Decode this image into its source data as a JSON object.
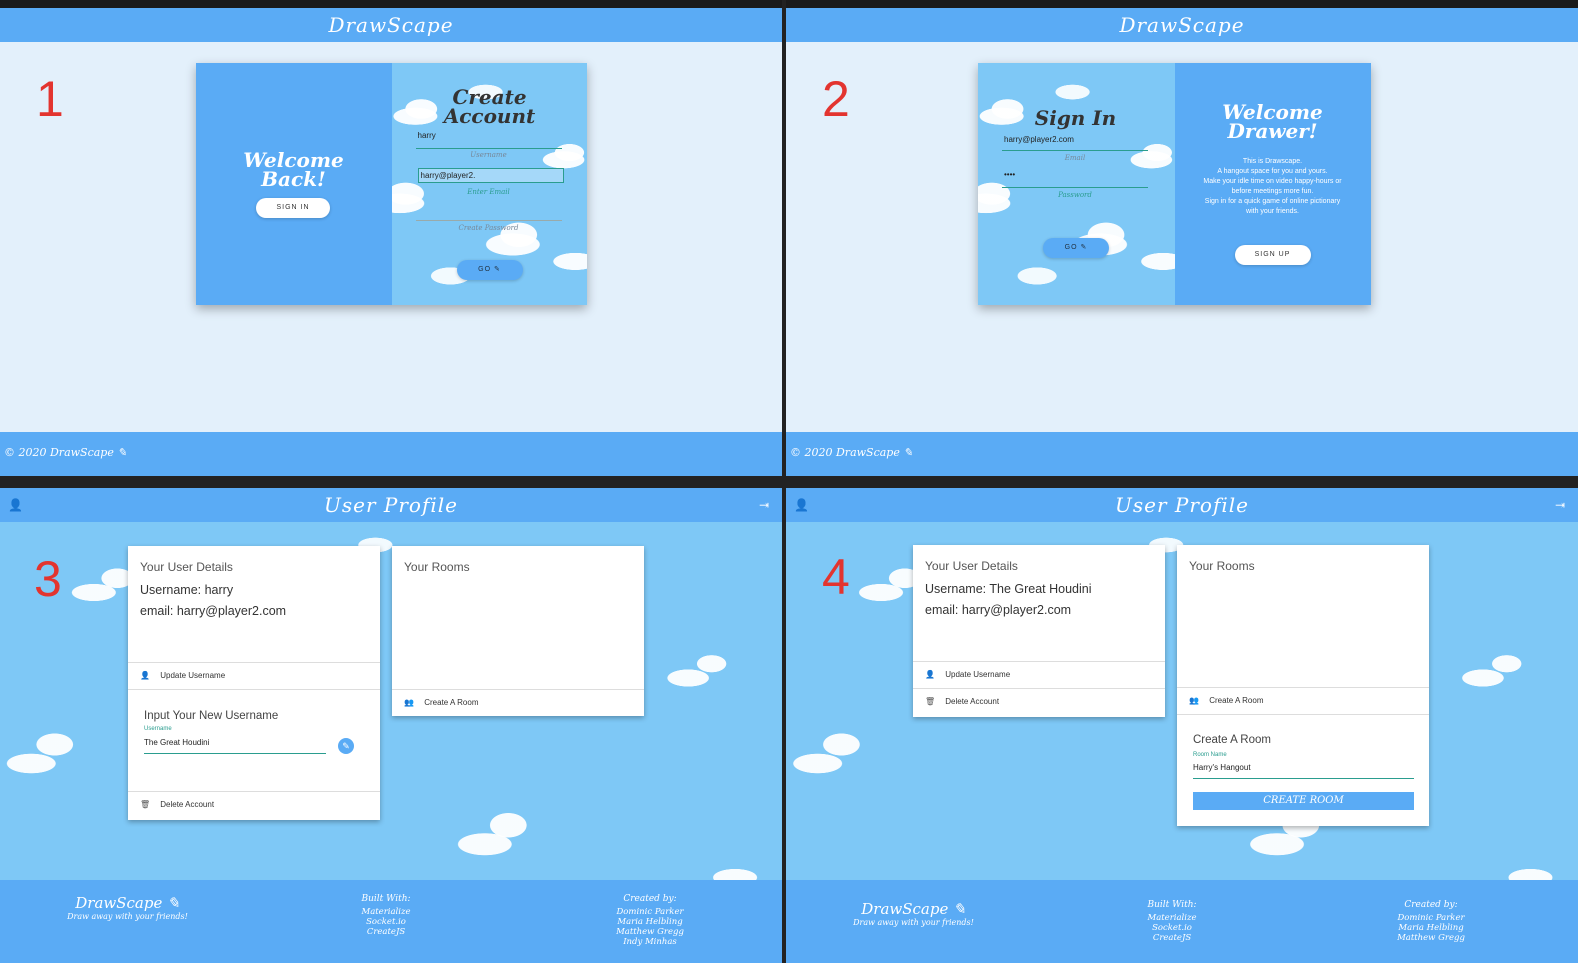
{
  "colors": {
    "primary": "#5aabf5",
    "light_bg": "#e3f0fb",
    "sky": "#7ec8f6",
    "accent_teal": "#2a9d8f",
    "step_number": "#e3342f"
  },
  "panel1": {
    "step": "1",
    "header_title": "DrawScape",
    "welcome_title": "Welcome Back!",
    "sign_in_button": "SIGN IN",
    "create_title": "Create Account",
    "username_value": "harry",
    "username_hint": "Username",
    "email_value": "harry@player2.",
    "email_hint": "Enter Email",
    "password_hint": "Create Password",
    "go_button": "GO",
    "copyright": "© 2020 DrawScape"
  },
  "panel2": {
    "step": "2",
    "header_title": "DrawScape",
    "sign_in_title": "Sign In",
    "email_value": "harry@player2.com",
    "email_hint": "Email",
    "password_value": "••••",
    "password_hint": "Password",
    "go_button": "GO",
    "welcome_title": "Welcome Drawer!",
    "intro_text": [
      "This is Drawscape.",
      "A hangout space for you and yours.",
      "Make your idle time on video happy-hours or",
      "before meetings more fun.",
      "Sign in for a quick game of online pictionary",
      "with your friends."
    ],
    "sign_up_button": "SIGN UP",
    "copyright": "© 2020 DrawScape"
  },
  "panel3": {
    "step": "3",
    "header_title": "User Profile",
    "details_title": "Your User Details",
    "username_line": "Username: harry",
    "email_line": "email: harry@player2.com",
    "update_username": "Update Username",
    "input_heading": "Input Your New Username",
    "input_label": "Username",
    "input_value": "The Great Houdini",
    "delete_account": "Delete Account",
    "rooms_title": "Your Rooms",
    "create_room": "Create A Room"
  },
  "panel4": {
    "step": "4",
    "header_title": "User Profile",
    "details_title": "Your User Details",
    "username_line": "Username: The Great Houdini",
    "email_line": "email: harry@player2.com",
    "update_username": "Update Username",
    "delete_account": "Delete Account",
    "rooms_title": "Your Rooms",
    "create_room": "Create A Room",
    "create_room_heading": "Create A Room",
    "room_label": "Room Name",
    "room_value": "Harry's Hangout",
    "create_room_button": "CREATE ROOM"
  },
  "footer": {
    "brand": "DrawScape",
    "tagline": "Draw away with your friends!",
    "built_with_heading": "Built With:",
    "built_with": [
      "Materialize",
      "Socket.io",
      "CreateJS"
    ],
    "created_by_heading": "Created by:",
    "creators": [
      "Dominic Parker",
      "Maria Helbling",
      "Matthew Gregg",
      "Indy Minhas"
    ]
  },
  "icons": [
    "pencil-icon",
    "person-icon",
    "logout-icon",
    "trash-icon",
    "group-icon",
    "edit-icon"
  ]
}
